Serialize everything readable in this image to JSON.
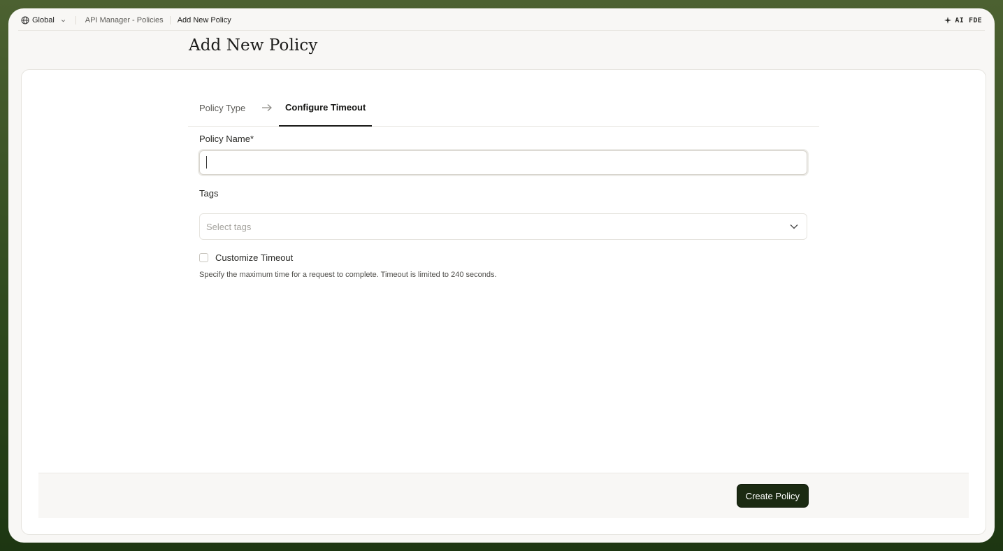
{
  "topbar": {
    "scope_label": "Global",
    "breadcrumb_parent": "API Manager - Policies",
    "breadcrumb_current": "Add New Policy",
    "ai_label": "AI",
    "user_label": "FDE"
  },
  "page": {
    "title": "Add New Policy"
  },
  "tabs": [
    {
      "label": "Policy Type",
      "active": false
    },
    {
      "label": "Configure Timeout",
      "active": true
    }
  ],
  "form": {
    "policy_name": {
      "label": "Policy Name*",
      "value": ""
    },
    "tags": {
      "label": "Tags",
      "placeholder": "Select tags"
    },
    "customize_timeout": {
      "label": "Customize Timeout",
      "checked": false,
      "help": "Specify the maximum time for a request to complete. Timeout is limited to 240 seconds."
    }
  },
  "footer": {
    "submit_label": "Create Policy"
  },
  "colors": {
    "frame_background": "#3d5527",
    "primary_button": "#1b2a12",
    "page_background": "#f8f7f5"
  }
}
